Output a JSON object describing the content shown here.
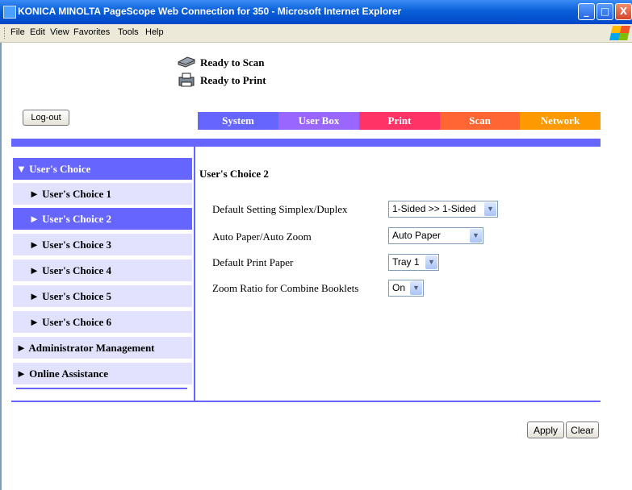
{
  "window": {
    "title": "KONICA MINOLTA PageScope Web Connection for 350 - Microsoft Internet Explorer",
    "controls": {
      "minimize": "_",
      "maximize": "□",
      "close": "X"
    }
  },
  "menubar": {
    "items": [
      "File",
      "Edit",
      "View",
      "Favorites",
      "Tools",
      "Help"
    ]
  },
  "status": {
    "scan": "Ready to Scan",
    "print": "Ready to Print"
  },
  "logout_label": "Log-out",
  "tabs": [
    {
      "label": "System",
      "color": "#6666ff"
    },
    {
      "label": "User Box",
      "color": "#9966ff"
    },
    {
      "label": "Print",
      "color": "#ff3366"
    },
    {
      "label": "Scan",
      "color": "#ff6633"
    },
    {
      "label": "Network",
      "color": "#ff9900"
    }
  ],
  "sidebar": {
    "items": [
      {
        "label": "▼ User's Choice"
      },
      {
        "label": "► User's Choice 1"
      },
      {
        "label": "► User's Choice 2"
      },
      {
        "label": "► User's Choice 3"
      },
      {
        "label": "► User's Choice 4"
      },
      {
        "label": "► User's Choice 5"
      },
      {
        "label": "► User's Choice 6"
      },
      {
        "label": "► Administrator Management"
      },
      {
        "label": "► Online Assistance"
      }
    ],
    "selected_index": 2
  },
  "main": {
    "title": "User's Choice 2",
    "settings": [
      {
        "label": "Default Setting Simplex/Duplex",
        "value": "1-Sided >> 1-Sided"
      },
      {
        "label": "Auto Paper/Auto Zoom",
        "value": "Auto Paper"
      },
      {
        "label": "Default Print Paper",
        "value": "Tray 1"
      },
      {
        "label": "Zoom Ratio for Combine Booklets",
        "value": "On"
      }
    ]
  },
  "buttons": {
    "apply": "Apply",
    "clear": "Clear"
  },
  "colors": {
    "accent": "#6666ff",
    "sidebar_bg": "#e2e2ff"
  }
}
